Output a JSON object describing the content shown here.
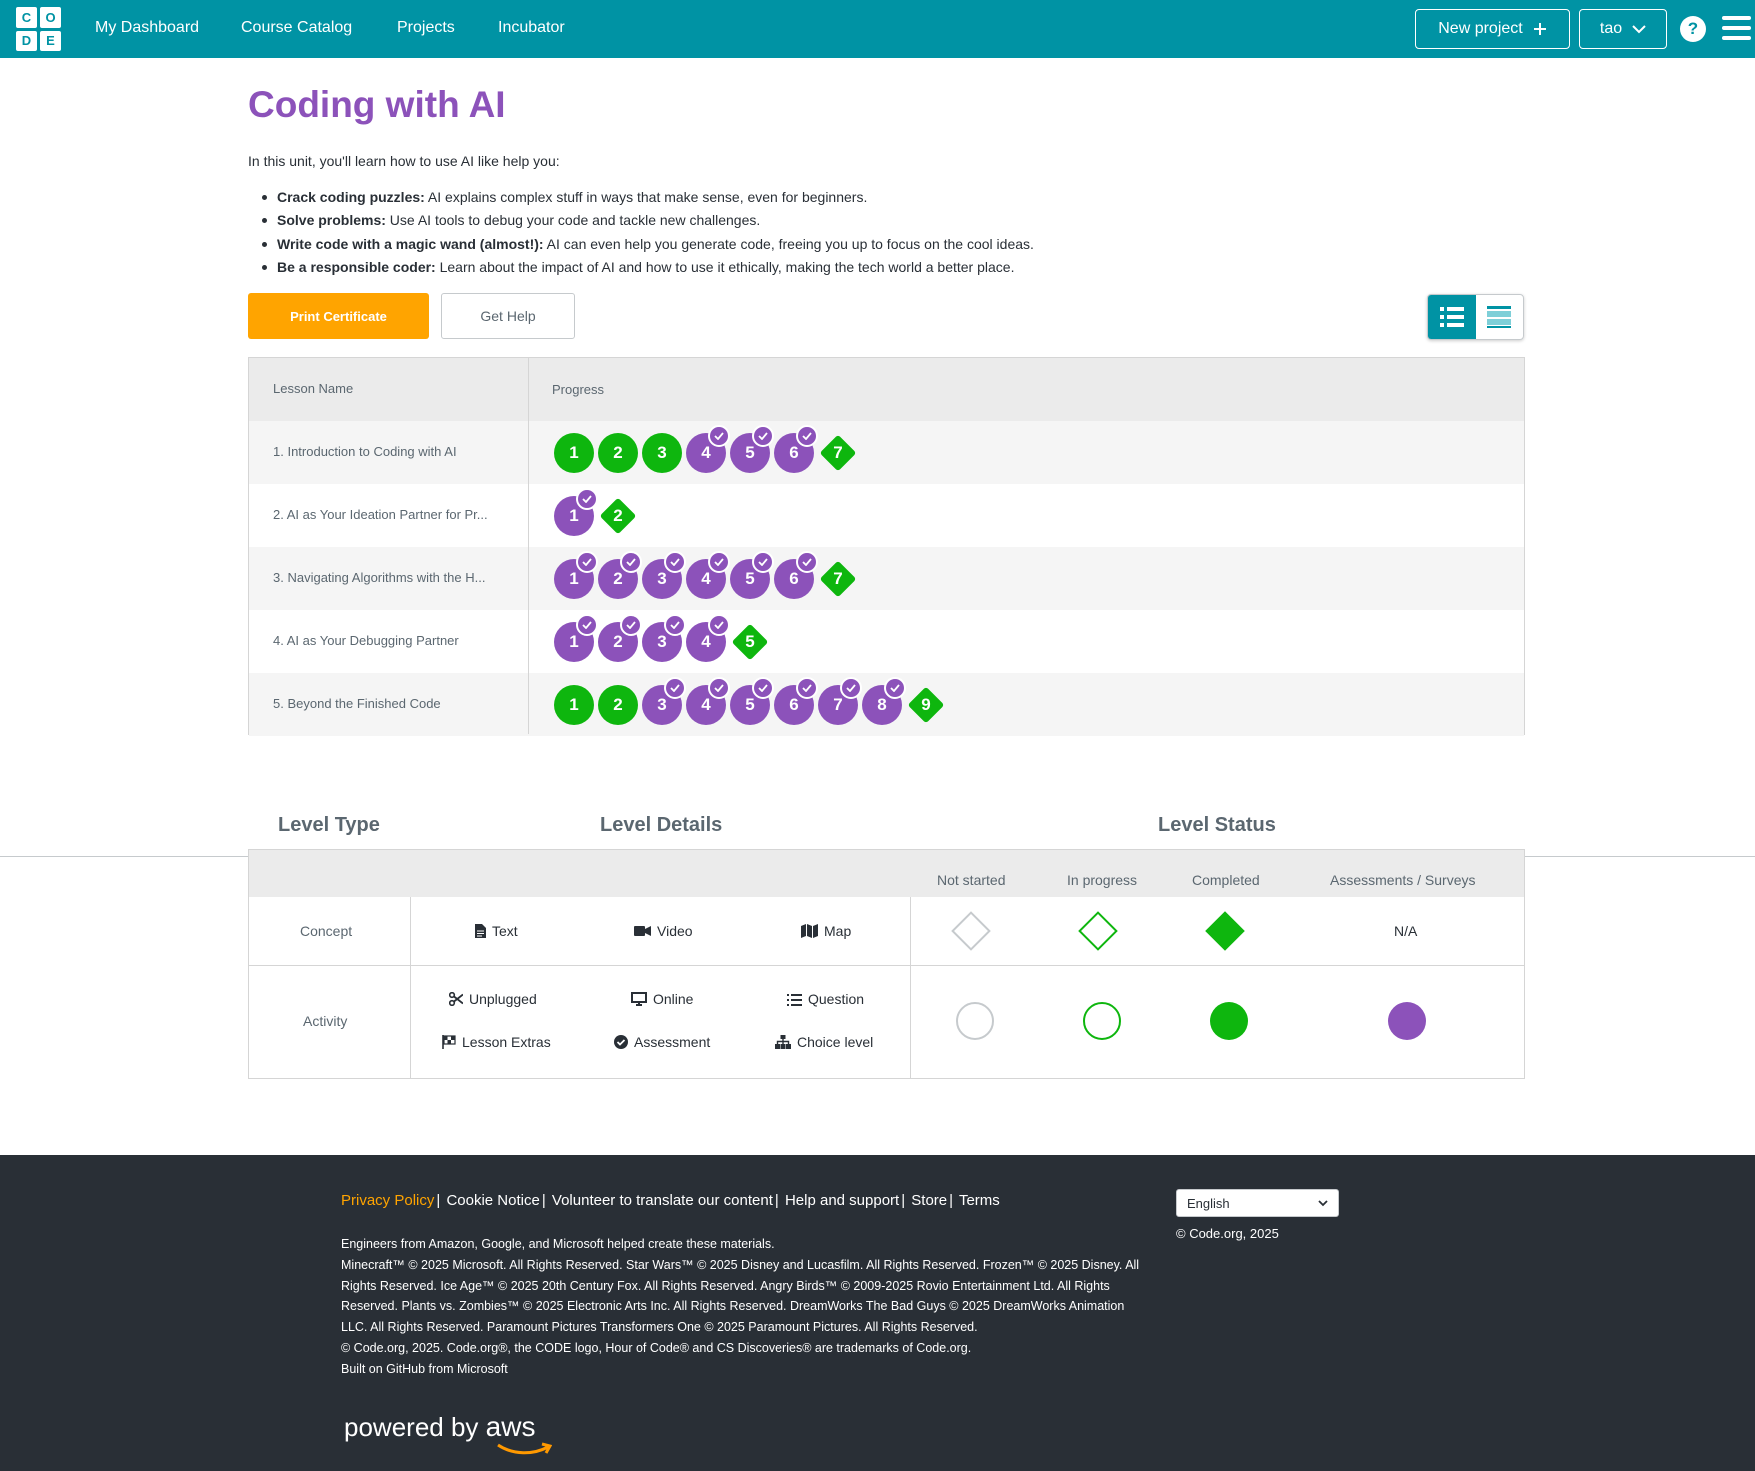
{
  "nav": {
    "logo": [
      "C",
      "O",
      "D",
      "E"
    ],
    "links": [
      "My Dashboard",
      "Course Catalog",
      "Projects",
      "Incubator"
    ],
    "new_project": "New project",
    "user": "tao",
    "help": "?"
  },
  "unit": {
    "title": "Coding with AI",
    "intro": "In this unit, you'll learn how to use AI like help you:",
    "bullets": [
      {
        "bold": "Crack coding puzzles:",
        "text": " AI explains complex stuff in ways that make sense, even for beginners."
      },
      {
        "bold": "Solve problems:",
        "text": " Use AI tools to debug your code and tackle new challenges."
      },
      {
        "bold": "Write code with a magic wand (almost!):",
        "text": " AI can even help you generate code, freeing you up to focus on the cool ideas."
      },
      {
        "bold": "Be a responsible coder:",
        "text": " Learn about the impact of AI and how to use it ethically, making the tech world a better place."
      }
    ],
    "print_certificate": "Print Certificate",
    "get_help": "Get Help"
  },
  "progress_table": {
    "headers": {
      "lesson": "Lesson Name",
      "progress": "Progress"
    },
    "lessons": [
      {
        "name": "1. Introduction to Coding with AI",
        "levels": [
          {
            "n": "1",
            "kind": "circle",
            "status": "completed"
          },
          {
            "n": "2",
            "kind": "circle",
            "status": "completed"
          },
          {
            "n": "3",
            "kind": "circle",
            "status": "completed"
          },
          {
            "n": "4",
            "kind": "circle",
            "status": "assessment"
          },
          {
            "n": "5",
            "kind": "circle",
            "status": "assessment"
          },
          {
            "n": "6",
            "kind": "circle",
            "status": "assessment"
          },
          {
            "n": "7",
            "kind": "diamond",
            "status": "completed"
          }
        ]
      },
      {
        "name": "2. AI as Your Ideation Partner for Pr...",
        "levels": [
          {
            "n": "1",
            "kind": "circle",
            "status": "assessment"
          },
          {
            "n": "2",
            "kind": "diamond",
            "status": "completed"
          }
        ]
      },
      {
        "name": "3. Navigating Algorithms with the H...",
        "levels": [
          {
            "n": "1",
            "kind": "circle",
            "status": "assessment"
          },
          {
            "n": "2",
            "kind": "circle",
            "status": "assessment"
          },
          {
            "n": "3",
            "kind": "circle",
            "status": "assessment"
          },
          {
            "n": "4",
            "kind": "circle",
            "status": "assessment"
          },
          {
            "n": "5",
            "kind": "circle",
            "status": "assessment"
          },
          {
            "n": "6",
            "kind": "circle",
            "status": "assessment"
          },
          {
            "n": "7",
            "kind": "diamond",
            "status": "completed"
          }
        ]
      },
      {
        "name": "4. AI as Your Debugging Partner",
        "levels": [
          {
            "n": "1",
            "kind": "circle",
            "status": "assessment"
          },
          {
            "n": "2",
            "kind": "circle",
            "status": "assessment"
          },
          {
            "n": "3",
            "kind": "circle",
            "status": "assessment"
          },
          {
            "n": "4",
            "kind": "circle",
            "status": "assessment"
          },
          {
            "n": "5",
            "kind": "diamond",
            "status": "completed"
          }
        ]
      },
      {
        "name": "5. Beyond the Finished Code",
        "levels": [
          {
            "n": "1",
            "kind": "circle",
            "status": "completed"
          },
          {
            "n": "2",
            "kind": "circle",
            "status": "completed"
          },
          {
            "n": "3",
            "kind": "circle",
            "status": "assessment"
          },
          {
            "n": "4",
            "kind": "circle",
            "status": "assessment"
          },
          {
            "n": "5",
            "kind": "circle",
            "status": "assessment"
          },
          {
            "n": "6",
            "kind": "circle",
            "status": "assessment"
          },
          {
            "n": "7",
            "kind": "circle",
            "status": "assessment"
          },
          {
            "n": "8",
            "kind": "circle",
            "status": "assessment"
          },
          {
            "n": "9",
            "kind": "diamond",
            "status": "completed"
          }
        ]
      }
    ]
  },
  "key": {
    "level_type": "Level Type",
    "level_details": "Level Details",
    "level_status": "Level Status",
    "statuses": [
      "Not started",
      "In progress",
      "Completed",
      "Assessments / Surveys"
    ],
    "concept": {
      "label": "Concept",
      "items": [
        "Text",
        "Video",
        "Map"
      ],
      "assessment": "N/A"
    },
    "activity": {
      "label": "Activity",
      "items": [
        "Unplugged",
        "Online",
        "Question",
        "Lesson Extras",
        "Assessment",
        "Choice level"
      ]
    }
  },
  "footer": {
    "links": [
      "Privacy Policy",
      "Cookie Notice",
      "Volunteer to translate our content",
      "Help and support",
      "Store",
      "Terms"
    ],
    "lines": [
      "Engineers from Amazon, Google, and Microsoft helped create these materials.",
      "Minecraft™ © 2025 Microsoft. All Rights Reserved. Star Wars™ © 2025 Disney and Lucasfilm. All Rights Reserved. Frozen™ © 2025 Disney. All Rights Reserved. Ice Age™ © 2025 20th Century Fox. All Rights Reserved. Angry Birds™ © 2009-2025 Rovio Entertainment Ltd. All Rights Reserved. Plants vs. Zombies™ © 2025 Electronic Arts Inc. All Rights Reserved. DreamWorks The Bad Guys © 2025 DreamWorks Animation LLC. All Rights Reserved. Paramount Pictures Transformers One © 2025 Paramount Pictures. All Rights Reserved.",
      "© Code.org, 2025. Code.org®, the CODE logo, Hour of Code® and CS Discoveries® are trademarks of Code.org.",
      "Built on GitHub from Microsoft"
    ],
    "language": "English",
    "copyright": "© Code.org, 2025",
    "powered_by": "powered by",
    "aws": "aws"
  },
  "colors": {
    "teal": "#0093a4",
    "purple": "#8c52ba",
    "green": "#0eb60e",
    "orange": "#ffa400",
    "footer": "#292f36"
  }
}
